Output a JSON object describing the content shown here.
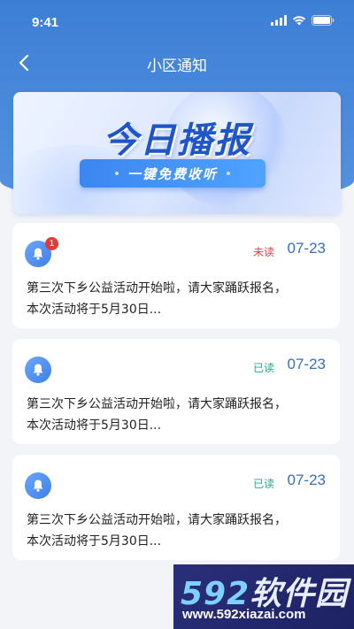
{
  "status_bar": {
    "time": "9:41"
  },
  "nav": {
    "title": "小区通知",
    "back_icon": "chevron-left-icon"
  },
  "banner": {
    "title": "今日播报",
    "button_label": "一键免费收听"
  },
  "notices": [
    {
      "status": "未读",
      "status_type": "unread",
      "date": "07-23",
      "badge": "1",
      "content_line1": "第三次下乡公益活动开始啦，请大家踊跃报名，",
      "content_line2": "本次活动将于5月30日..."
    },
    {
      "status": "已读",
      "status_type": "read",
      "date": "07-23",
      "content_line1": "第三次下乡公益活动开始啦，请大家踊跃报名，",
      "content_line2": "本次活动将于5月30日..."
    },
    {
      "status": "已读",
      "status_type": "read",
      "date": "07-23",
      "content_line1": "第三次下乡公益活动开始啦，请大家踊跃报名，",
      "content_line2": "本次活动将于5月30日..."
    }
  ],
  "watermark": {
    "logo_num": "592",
    "logo_text": "软件园",
    "url": "www.592xiazai.com"
  },
  "colors": {
    "header": "#3d7fd6",
    "unread": "#e0463c",
    "read": "#29a58d",
    "date": "#3a6fb8"
  }
}
